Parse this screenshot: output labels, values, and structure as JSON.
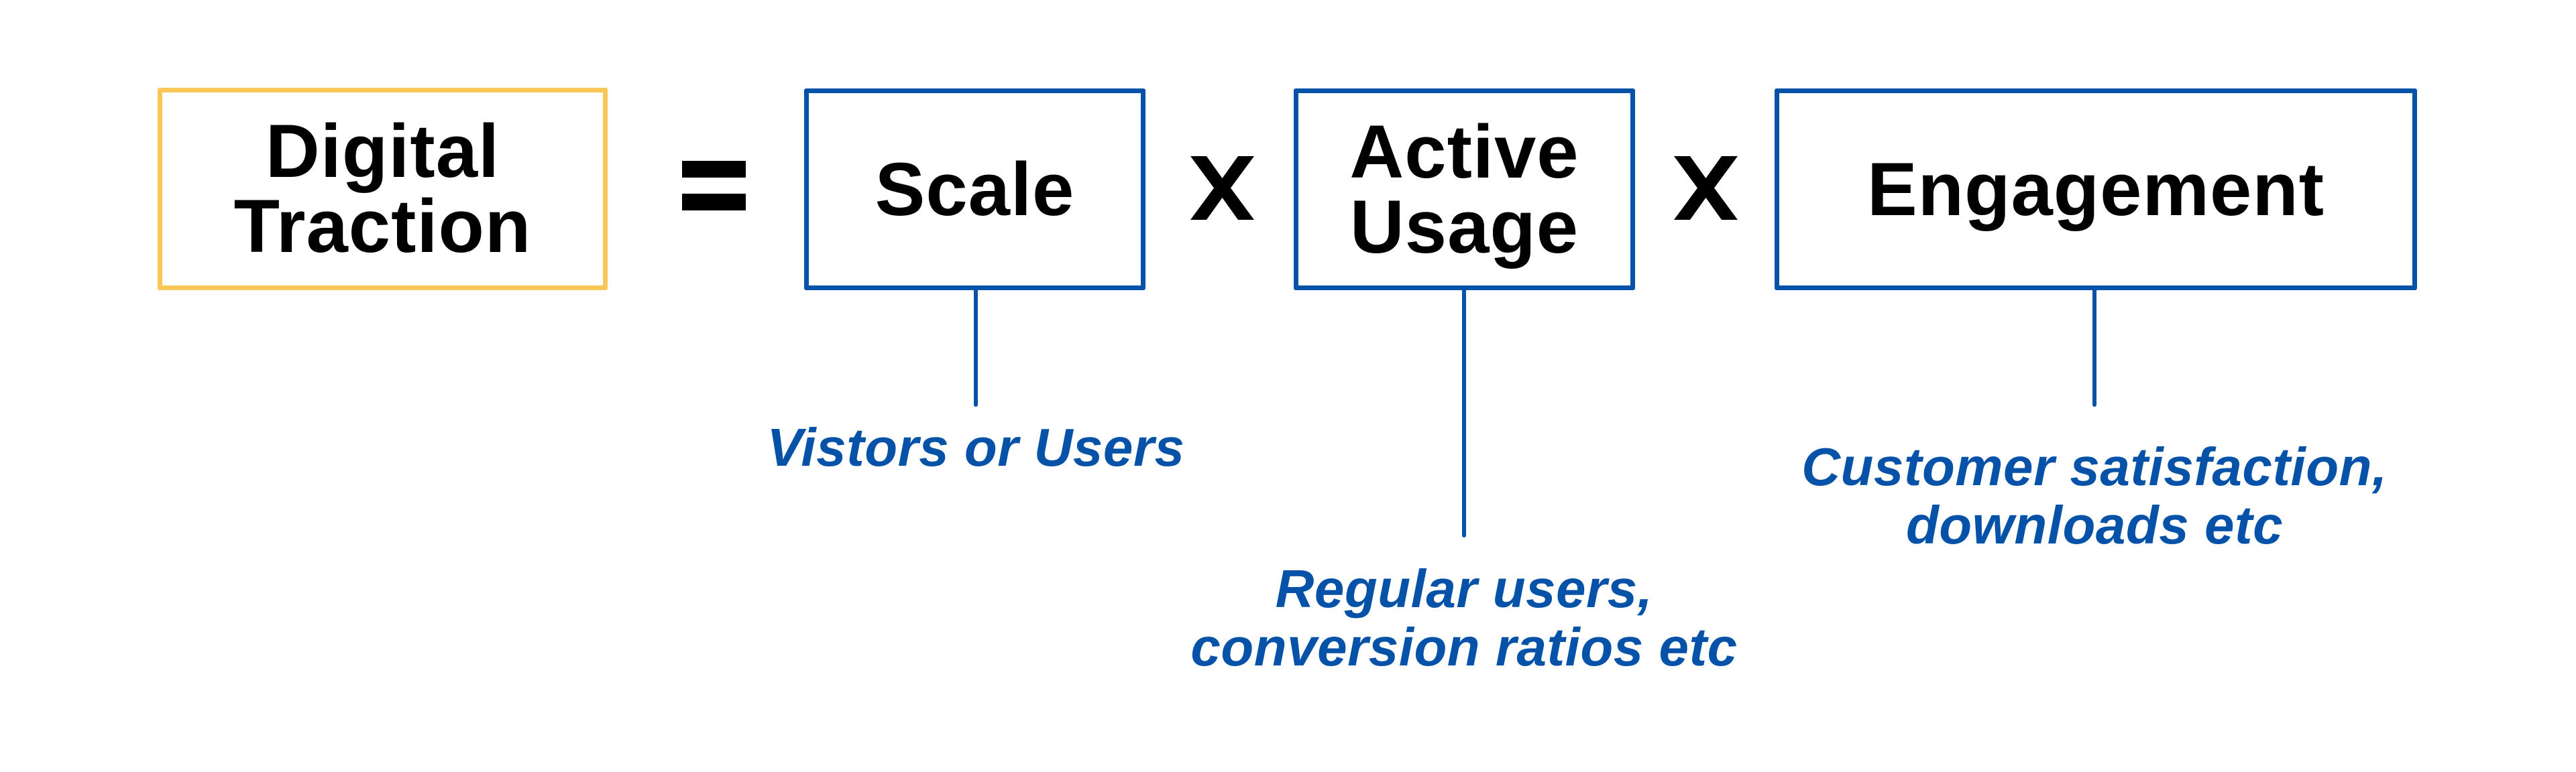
{
  "diagram": {
    "result": {
      "label": "Digital\nTraction",
      "border_color": "#FAC655"
    },
    "equals_symbol": "=",
    "multiply_symbol": "X",
    "factors": [
      {
        "label": "Scale",
        "description": "Vistors or Users"
      },
      {
        "label": "Active\nUsage",
        "description": "Regular users,\nconversion ratios etc"
      },
      {
        "label": "Engagement",
        "description": "Customer satisfaction,\ndownloads etc"
      }
    ],
    "colors": {
      "factor_border": "#0652A8",
      "description_text": "#0652A8",
      "box_text": "#000000"
    }
  }
}
